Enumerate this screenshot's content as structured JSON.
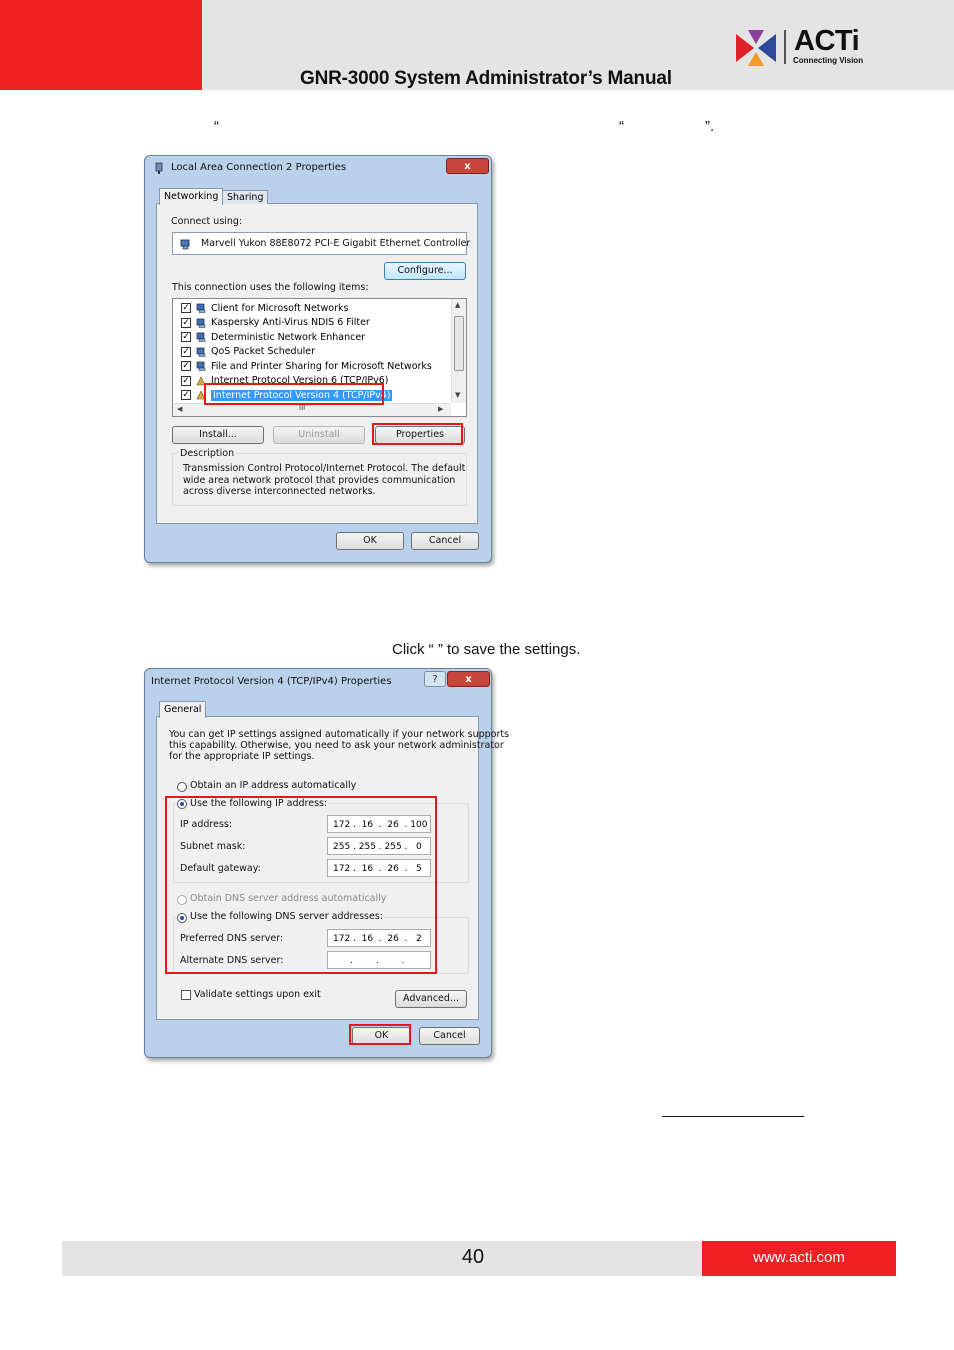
{
  "header": {
    "manual_title": "GNR-3000 System Administrator’s Manual",
    "logo": {
      "name": "ACTi",
      "tagline": "Connecting Vision"
    }
  },
  "text": {
    "line1_quote_a": "“",
    "line1_quote_b": "“",
    "line1_quote_c": "”.",
    "instruction": "Click “      ” to save the settings."
  },
  "dialog1": {
    "title": "Local Area Connection 2 Properties",
    "close": "x",
    "tabs": [
      "Networking",
      "Sharing"
    ],
    "connect_using_label": "Connect using:",
    "adapter": "Marvell Yukon 88E8072 PCI-E Gigabit Ethernet Controller",
    "configure_button": "Configure...",
    "items_label": "This connection uses the following items:",
    "items": [
      {
        "label": "Client for Microsoft Networks",
        "checked": true
      },
      {
        "label": "Kaspersky Anti-Virus NDIS 6 Filter",
        "checked": true
      },
      {
        "label": "Deterministic Network Enhancer",
        "checked": true
      },
      {
        "label": "QoS Packet Scheduler",
        "checked": true
      },
      {
        "label": "File and Printer Sharing for Microsoft Networks",
        "checked": true
      },
      {
        "label": "Internet Protocol Version 6 (TCP/IPv6)",
        "checked": true
      },
      {
        "label": "Internet Protocol Version 4 (TCP/IPv4)",
        "checked": true,
        "selected": true
      }
    ],
    "hscroll_thumb": "III",
    "install_button": "Install...",
    "uninstall_button": "Uninstall",
    "properties_button": "Properties",
    "description_label": "Description",
    "description_lines": [
      "Transmission Control Protocol/Internet Protocol. The default",
      "wide area network protocol that provides communication",
      "across diverse interconnected networks."
    ],
    "ok_button": "OK",
    "cancel_button": "Cancel"
  },
  "dialog2": {
    "title": "Internet Protocol Version 4 (TCP/IPv4) Properties",
    "help": "?",
    "close": "x",
    "tab": "General",
    "intro_lines": [
      "You can get IP settings assigned automatically if your network supports",
      "this capability. Otherwise, you need to ask your network administrator",
      "for the appropriate IP settings."
    ],
    "obtain_ip_auto": "Obtain an IP address automatically",
    "use_following_ip": "Use the following IP address:",
    "ip_label": "IP address:",
    "ip_value": "172 .  16  .  26  . 100",
    "subnet_label": "Subnet mask:",
    "subnet_value": "255 . 255 . 255 .   0",
    "gateway_label": "Default gateway:",
    "gateway_value": "172 .  16  .  26  .   5",
    "obtain_dns_auto": "Obtain DNS server address automatically",
    "use_following_dns": "Use the following DNS server addresses:",
    "preferred_dns_label": "Preferred DNS server:",
    "preferred_dns_value": "172 .  16  .  26  .   2",
    "alternate_dns_label": "Alternate DNS server:",
    "alternate_dns_value": "      .        .        .",
    "validate_label": "Validate settings upon exit",
    "advanced_button": "Advanced...",
    "ok_button": "OK",
    "cancel_button": "Cancel"
  },
  "footer": {
    "page_number": "40",
    "url": "www.acti.com"
  },
  "colors": {
    "brand_red": "#ee2024",
    "band_gray": "#e4e4e4",
    "highlight_red": "#e8151b"
  }
}
